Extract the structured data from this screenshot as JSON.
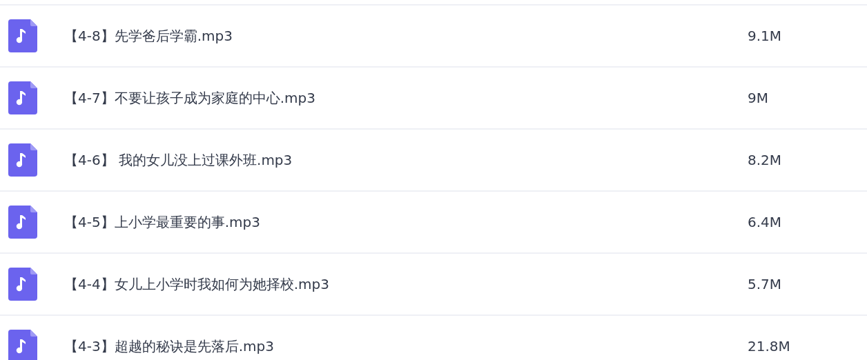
{
  "files": [
    {
      "name": "【4-8】先学爸后学霸.mp3",
      "size": "9.1M"
    },
    {
      "name": "【4-7】不要让孩子成为家庭的中心.mp3",
      "size": "9M"
    },
    {
      "name": "【4-6】 我的女儿没上过课外班.mp3",
      "size": "8.2M"
    },
    {
      "name": "【4-5】上小学最重要的事.mp3",
      "size": "6.4M"
    },
    {
      "name": "【4-4】女儿上小学时我如何为她择校.mp3",
      "size": "5.7M"
    },
    {
      "name": "【4-3】超越的秘诀是先落后.mp3",
      "size": "21.8M"
    }
  ]
}
